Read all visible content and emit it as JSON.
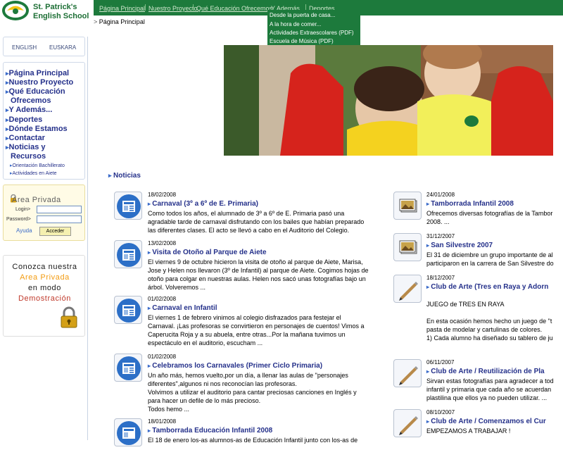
{
  "logo": {
    "line1": "St. Patrick's",
    "line2": "English School"
  },
  "topnav": {
    "items": [
      "Página Principal",
      "Nuestro Proyecto",
      "Qué Educación Ofrecemos",
      "Y Además...",
      "Deportes"
    ],
    "separator": "|"
  },
  "submenu": {
    "items": [
      "Desde la puerta de casa...",
      "A la hora de comer...",
      "Actividades Extraescolares (PDF)",
      "Escuela de Música (PDF)"
    ]
  },
  "breadcrumb": {
    "arrow": ">",
    "current": "Página Principal"
  },
  "languages": [
    "ENGLISH",
    "EUSKARA"
  ],
  "menu": {
    "items": [
      "Página Principal",
      "Nuestro Proyecto",
      "Qué Educación",
      "Ofrecemos",
      "Y Además...",
      "Deportes",
      "Dónde Estamos",
      "Contactar",
      "Noticias y",
      "Recursos"
    ],
    "subitems": [
      "Orientación Bachillerato",
      "Actividades en Aiete"
    ]
  },
  "private_area": {
    "title": "Area Privada",
    "login_label": "Login",
    "password_label": "Password",
    "help_link": "Ayuda",
    "submit_button": "Acceder"
  },
  "demo_box": {
    "line1": "Conozca nuestra",
    "line2": "Area Privada",
    "line3": "en modo",
    "line4": "Demostración"
  },
  "news_heading": "Noticias",
  "news_left": [
    {
      "date": "18/02/2008",
      "title": "Carnaval (3º a 6º de E. Primaria)",
      "body": "Como todos los años, el alumnado de 3º a 6º de E. Primaria pasó una\nagradable tarde de carnaval disfrutando con los bailes que habían preparado\nlas diferentes clases. El acto se llevó a cabo en el Auditorio del Colegio."
    },
    {
      "date": "13/02/2008",
      "title": "Visita de Otoño al Parque de Aiete",
      "body": "El viernes 9 de octubre hicieron la visita de otoño al parque de Aiete, Marisa,\nJose y Helen nos llevaron (3º de Infantil) al parque de Aiete. Cogimos hojas de\notoño para colgar en nuestras aulas. Helen nos sacó unas fotografías bajo un\nárbol. Volveremos ..."
    },
    {
      "date": "01/02/2008",
      "title": "Carnaval en Infantil",
      "body": "El viernes 1 de febrero vinimos al colegio disfrazados para festejar el\nCarnaval. ¡Las profesoras se convirtieron en personajes de cuentos! Vimos a\nCaperucita Roja y a su abuela, entre otras...Por la mañana tuvimos un\nespectáculo en el auditorio, escucham ..."
    },
    {
      "date": "01/02/2008",
      "title": "Celebramos los Carnavales (Primer Ciclo Primaria)",
      "body": "Un año más, hemos vuelto,por un día, a llenar las aulas de \"personajes\ndiferentes\",algunos ni nos reconocían las profesoras.\nVolvimos a utilizar el auditorio para cantar preciosas canciones en Inglés y\npara hacer un defile de lo más precioso.\nTodos hemo ..."
    },
    {
      "date": "18/01/2008",
      "title": "Tamborrada Educación Infantil 2008",
      "body": "El 18 de enero los-as alumnos-as de Educación Infantil junto con los-as de"
    }
  ],
  "news_right": [
    {
      "date": "24/01/2008",
      "title": "Tamborrada Infantil 2008",
      "body": "Ofrecemos diversas fotografías de la Tambor\n2008. ..."
    },
    {
      "date": "31/12/2007",
      "title": "San Silvestre 2007",
      "body": "El 31 de diciembre un grupo importante de al\nparticiparon en la carrera de San Silvestre do"
    },
    {
      "date": "18/12/2007",
      "title": "Club de Arte (Tres en Raya y Adorn",
      "body": "JUEGO de TRES EN RAYA\n\nEn esta ocasión hemos hecho un juego de \"t\npasta de modelar y cartulinas de colores.\n1) Cada alumno ha diseñado su tablero de ju\n\n..."
    },
    {
      "date": "06/11/2007",
      "title": "Club de Arte / Reutilización de Pla",
      "body": "Sirvan estas fotografías para agradecer a tod\ninfantil y primaria que cada año se acuerdan\nplastilina que ellos ya no pueden utilizar. ..."
    },
    {
      "date": "08/10/2007",
      "title": "Club de Arte / Comenzamos el Cur",
      "body": "EMPEZAMOS A TRABAJAR !"
    }
  ],
  "colors": {
    "nav_green": "#1d7a3c",
    "link_blue": "#24308a",
    "accent_orange": "#f39c12",
    "demo_red": "#c0392b"
  }
}
